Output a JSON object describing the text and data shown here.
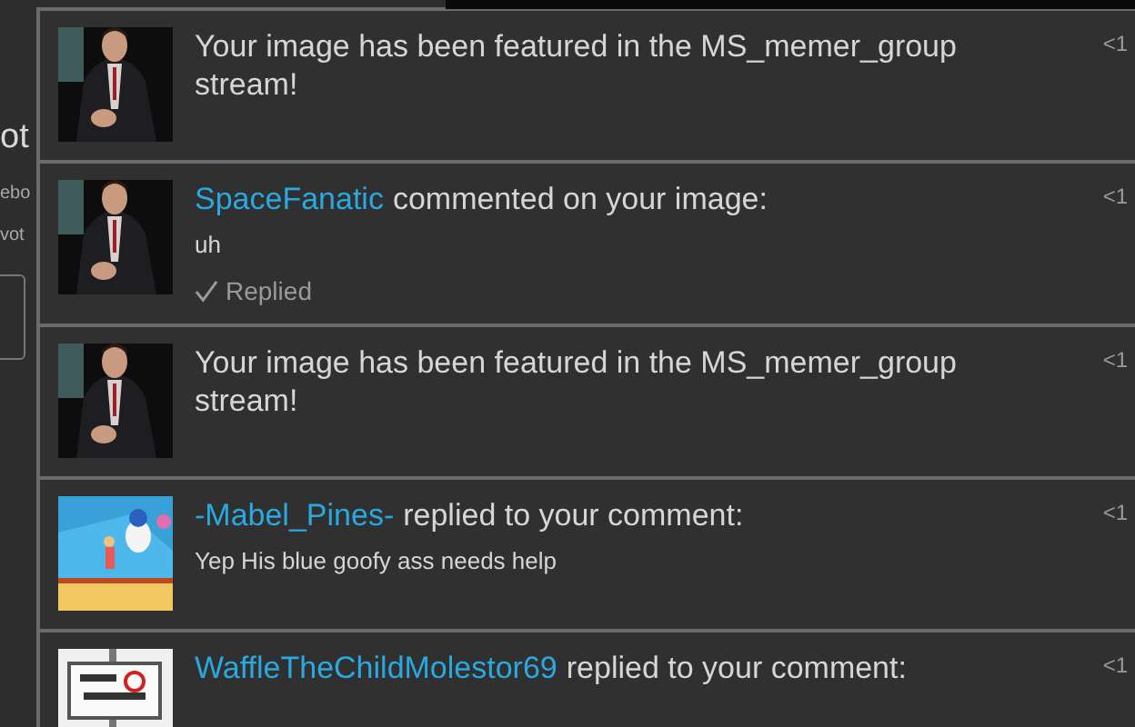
{
  "background_page": {
    "heading": "ot",
    "line_1": "ebo",
    "line_2": "vot"
  },
  "notifications": [
    {
      "kind": "featured",
      "message": "Your image has been featured in the MS_memer_group stream!",
      "time": "<1"
    },
    {
      "kind": "comment",
      "user": "SpaceFanatic",
      "message": "commented on your image:",
      "comment": "uh",
      "replied": true,
      "replied_label": "Replied",
      "time": "<1"
    },
    {
      "kind": "featured",
      "message": "Your image has been featured in the MS_memer_group stream!",
      "time": "<1"
    },
    {
      "kind": "comment",
      "user": "-Mabel_Pines-",
      "message": "replied to your comment:",
      "comment": "Yep His blue goofy ass needs help",
      "time": "<1"
    },
    {
      "kind": "comment",
      "user": "WaffleTheChildMolestor69",
      "message": "replied to your comment:",
      "time": "<1"
    }
  ]
}
